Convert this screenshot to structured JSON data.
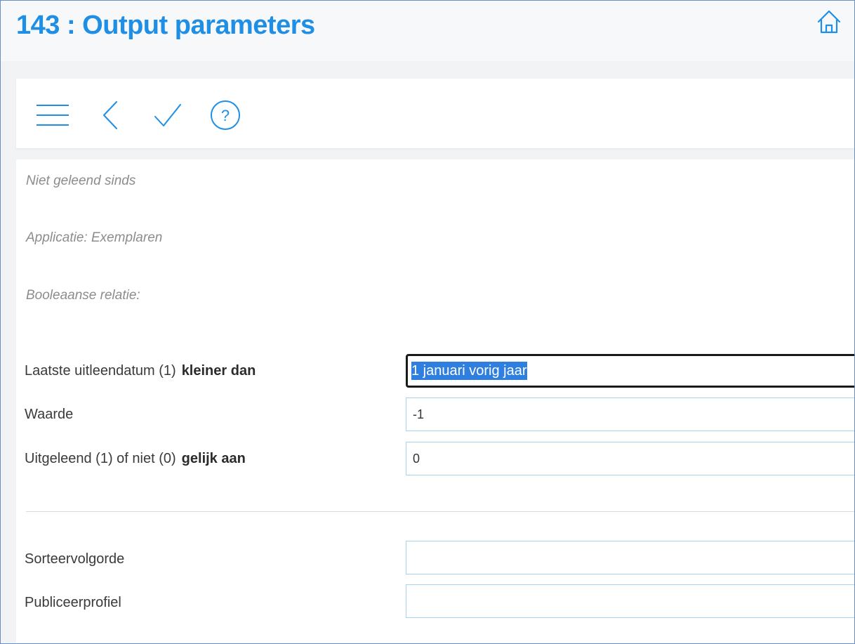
{
  "header": {
    "title": "143 : Output parameters",
    "home_icon": "home-icon"
  },
  "toolbar": {
    "menu_icon": "hamburger-menu-icon",
    "back_icon": "chevron-left-icon",
    "confirm_icon": "checkmark-icon",
    "help_icon": "question-circle-icon",
    "accent_color": "#1f8fe6"
  },
  "info": {
    "line1": "Niet geleend sinds",
    "line2": "Applicatie: Exemplaren",
    "line3": "Booleaanse relatie:"
  },
  "criteria": [
    {
      "label": "Laatste uitleendatum (1)",
      "operator": "kleiner dan",
      "value": "1 januari vorig jaar"
    },
    {
      "label": "Waarde",
      "operator": "",
      "value": "-1"
    },
    {
      "label": "Uitgeleend (1) of niet (0)",
      "operator": "gelijk aan",
      "value": "0"
    }
  ],
  "output": {
    "sort_label": "Sorteervolgorde",
    "sort_value": "",
    "profile_label": "Publiceerprofiel",
    "profile_value": ""
  }
}
